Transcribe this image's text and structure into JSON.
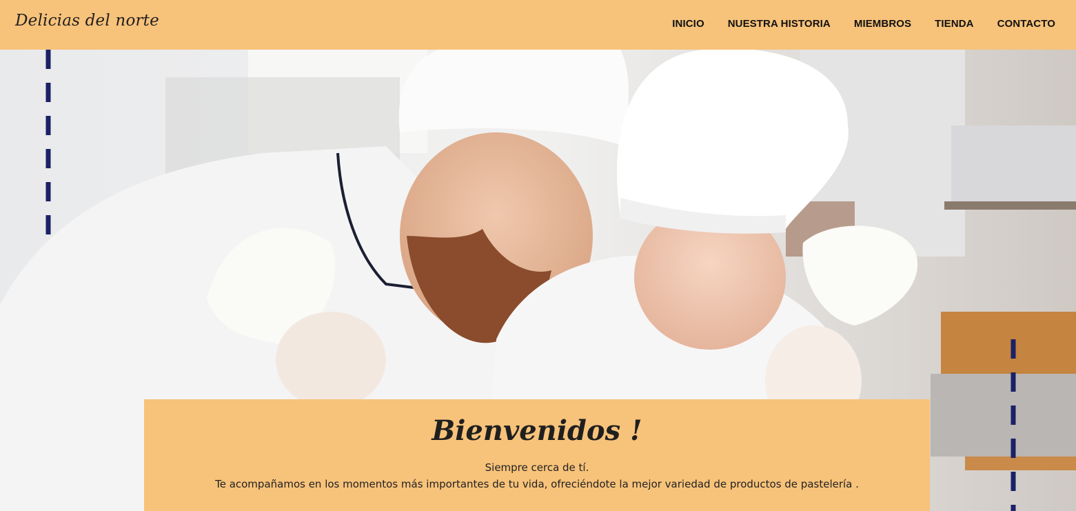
{
  "navbar": {
    "brand": "Delicias del norte",
    "links": [
      "INICIO",
      "NUESTRA HISTORIA",
      "MIEMBROS",
      "TIENDA",
      "CONTACTO"
    ]
  },
  "hero": {
    "image_description_icon": "bakers-photo"
  },
  "welcome": {
    "title": "Bienvenidos !",
    "line1": "Siempre cerca de tí.",
    "line2": "Te acompañamos en los momentos más importantes de tu vida, ofreciéndote la mejor variedad de productos de pastelería ."
  },
  "colors": {
    "navbar_bg": "#f7c27a",
    "accent_dashes": "#1a2166"
  }
}
